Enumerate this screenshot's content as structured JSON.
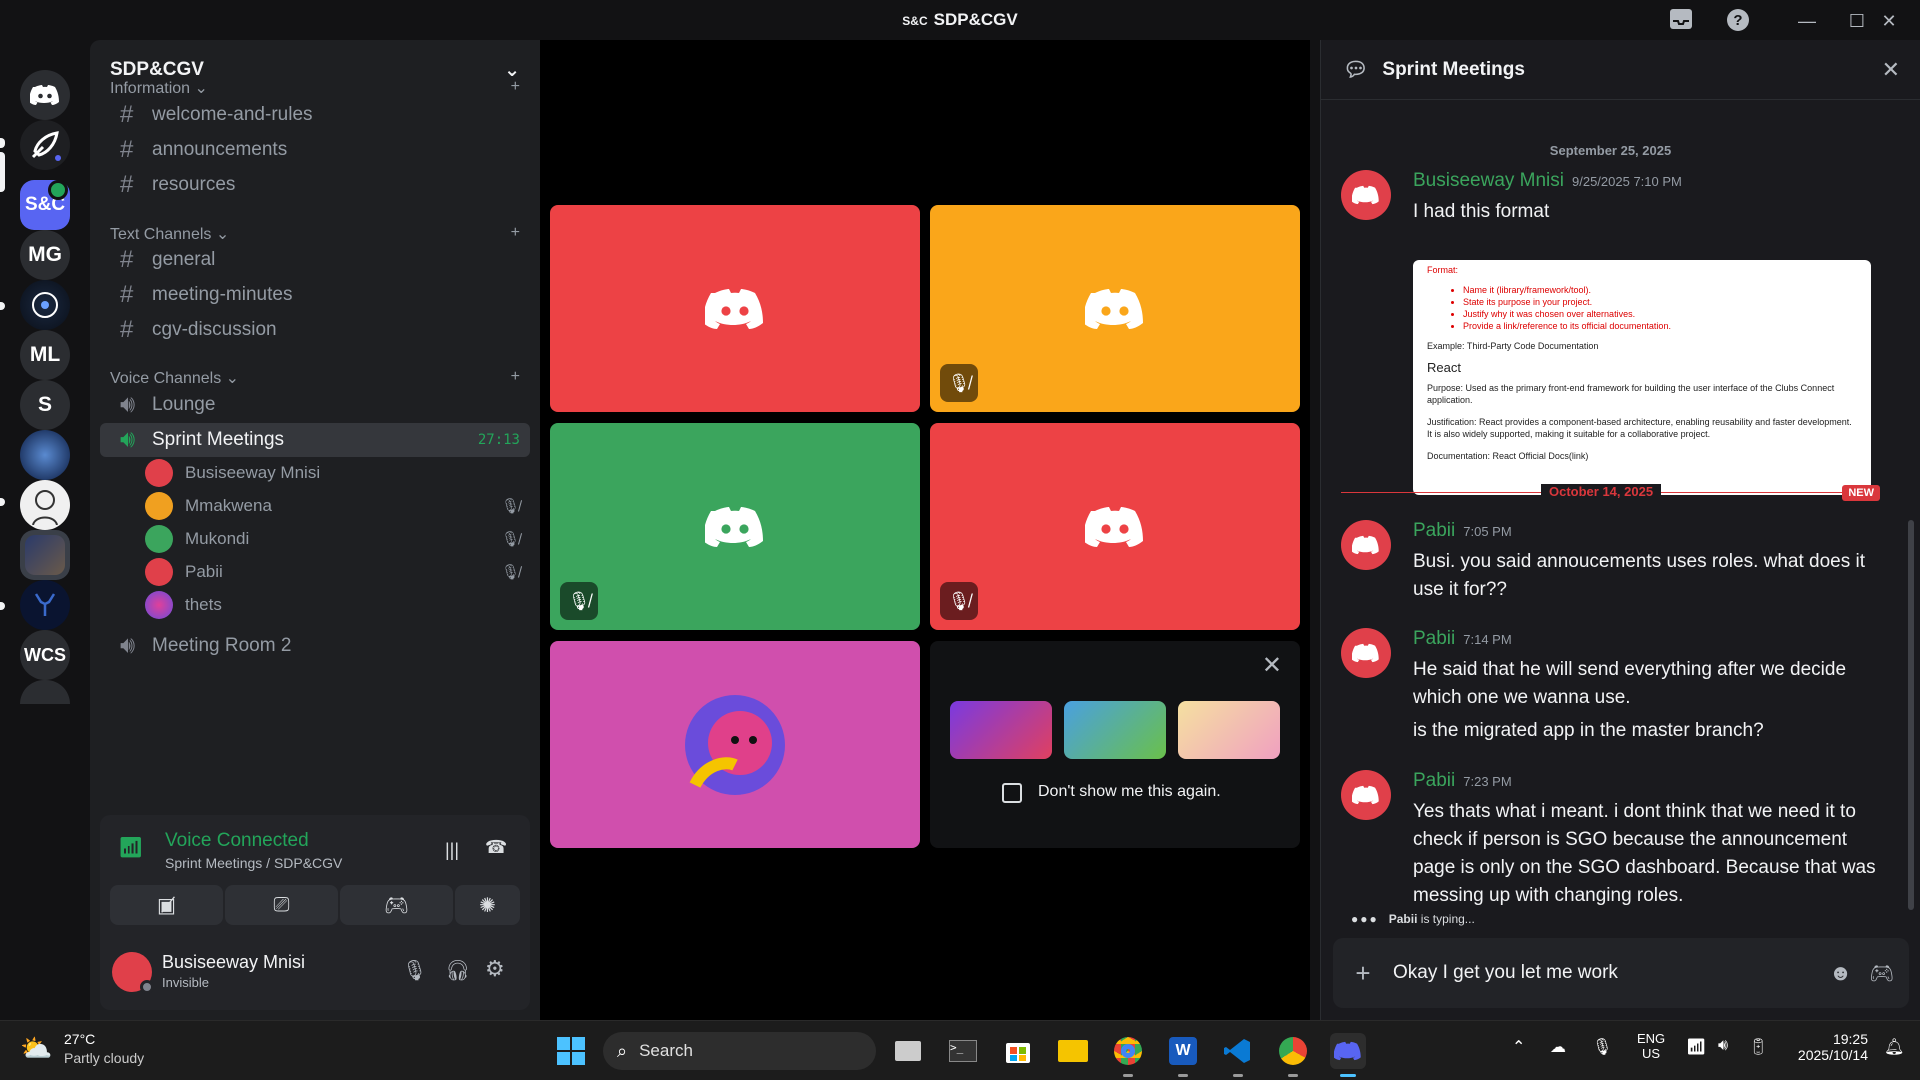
{
  "window": {
    "title_logo": "S&C",
    "title": "SDP&CGV",
    "controls": {
      "minimize": "—",
      "maximize": "☐",
      "close": "✕"
    }
  },
  "rail": {
    "servers": [
      {
        "label": "S&C"
      },
      {
        "label": "MG"
      },
      {
        "label": "ML"
      },
      {
        "label": "S"
      },
      {
        "label": "WCS"
      }
    ]
  },
  "sidebar": {
    "guild_name": "SDP&CGV",
    "categories": {
      "information": "Information",
      "text": "Text Channels",
      "voice": "Voice Channels"
    },
    "info_channels": [
      "welcome-and-rules",
      "announcements",
      "resources"
    ],
    "text_channels": [
      "general",
      "meeting-minutes",
      "cgv-discussion"
    ],
    "voice_channels": {
      "lounge": "Lounge",
      "active": "Sprint Meetings",
      "active_time": "27:13",
      "room2": "Meeting Room 2"
    },
    "voice_users": [
      {
        "name": "Busiseeway Mnisi",
        "color": "#e0404a",
        "muted": false
      },
      {
        "name": "Mmakwena",
        "color": "#f0a020",
        "muted": true
      },
      {
        "name": "Mukondi",
        "color": "#3ba55d",
        "muted": true
      },
      {
        "name": "Pabii",
        "color": "#e0404a",
        "muted": true
      },
      {
        "name": "thets",
        "color": "#6a4cdb",
        "muted": false
      }
    ]
  },
  "voice_panel": {
    "status": "Voice Connected",
    "location": "Sprint Meetings / SDP&CGV",
    "user_name": "Busiseeway Mnisi",
    "user_status": "Invisible"
  },
  "stage": {
    "tiles": [
      {
        "color": "#ed4245",
        "muted": false
      },
      {
        "color": "#faa61a",
        "muted": true
      },
      {
        "color": "#3ba55d",
        "muted": true
      },
      {
        "color": "#ed4245",
        "muted": true
      },
      {
        "color": "#d04fad",
        "muted": false
      }
    ],
    "promo": {
      "dont_show": "Don't show me this again."
    }
  },
  "thread": {
    "title": "Sprint Meetings",
    "date1": "September 25, 2025",
    "date2": "October 14, 2025",
    "new_badge": "NEW",
    "messages": [
      {
        "author": "Busiseeway Mnisi",
        "time": "9/25/2025 7:10 PM",
        "text": "I had this format"
      },
      {
        "author": "Pabii",
        "time": "7:05 PM",
        "text": "Busi. you said annoucements uses roles. what does it use it for??"
      },
      {
        "author": "Pabii",
        "time": "7:14 PM",
        "text": "He said that he will send everything after we decide which one we wanna use.",
        "text2": "is the migrated app in the master branch?"
      },
      {
        "author": "Pabii",
        "time": "7:23 PM",
        "text": "Yes thats what i meant. i dont think that we need it to check if person is SGO because the announcement page is only on the SGO dashboard. Because that was messing up with changing roles."
      }
    ],
    "attachment": {
      "format_label": "Format:",
      "bullets": [
        "Name it (library/framework/tool).",
        "State its purpose in your project.",
        "Justify why it was chosen over alternatives.",
        "Provide a link/reference to its official documentation."
      ],
      "example": "Example: Third-Party Code Documentation",
      "heading": "React",
      "purpose": "Purpose: Used as the primary front-end framework for building the user interface of the Clubs Connect application.",
      "justification": "Justification: React provides a component-based architecture, enabling reusability and faster development. It is also widely supported, making it suitable for a collaborative project.",
      "documentation": "Documentation: React Official Docs(link)"
    },
    "typing_user": "Pabii",
    "typing_suffix": " is typing...",
    "composer_text": "Okay I get you let me work"
  },
  "taskbar": {
    "weather_temp": "27°C",
    "weather_desc": "Partly cloudy",
    "search": "Search",
    "lang1": "ENG",
    "lang2": "US",
    "time": "19:25",
    "date": "2025/10/14"
  }
}
